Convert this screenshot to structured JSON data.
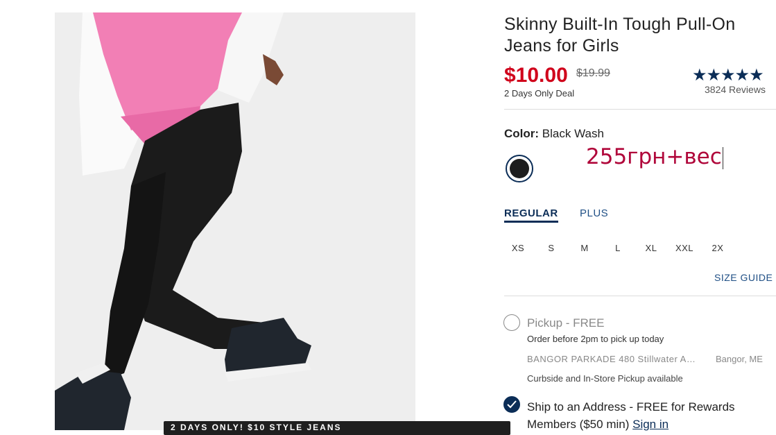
{
  "product": {
    "title": "Skinny Built-In Tough Pull-On Jeans for Girls",
    "price": "$10.00",
    "original_price": "$19.99",
    "deal_text": "2 Days Only Deal",
    "rating_stars": "★★★★★",
    "reviews": "3824 Reviews"
  },
  "color": {
    "label": "Color:",
    "value": "Black Wash",
    "swatch_color": "#1d1d1d"
  },
  "annotation": "255грн+вес",
  "fit_tabs": [
    {
      "label": "REGULAR",
      "active": true
    },
    {
      "label": "PLUS",
      "active": false
    }
  ],
  "sizes": [
    "XS",
    "S",
    "M",
    "L",
    "XL",
    "XXL",
    "2X"
  ],
  "size_guide": "SIZE GUIDE",
  "fulfillment": {
    "pickup": {
      "label": "Pickup - FREE",
      "sub": "Order before 2pm to pick up today",
      "store": "BANGOR PARKADE 480 Stillwater A…",
      "city": "Bangor, ME",
      "note": "Curbside and In-Store Pickup available",
      "selected": false
    },
    "ship": {
      "label": "Ship to an Address - FREE for Rewards Members ($50 min)",
      "link": "Sign in",
      "selected": true
    }
  },
  "promo_bar": "2 DAYS ONLY! $10 STYLE JEANS",
  "colors": {
    "sale_red": "#d0021b",
    "navy": "#0b2d57",
    "annotation": "#b0063a"
  }
}
